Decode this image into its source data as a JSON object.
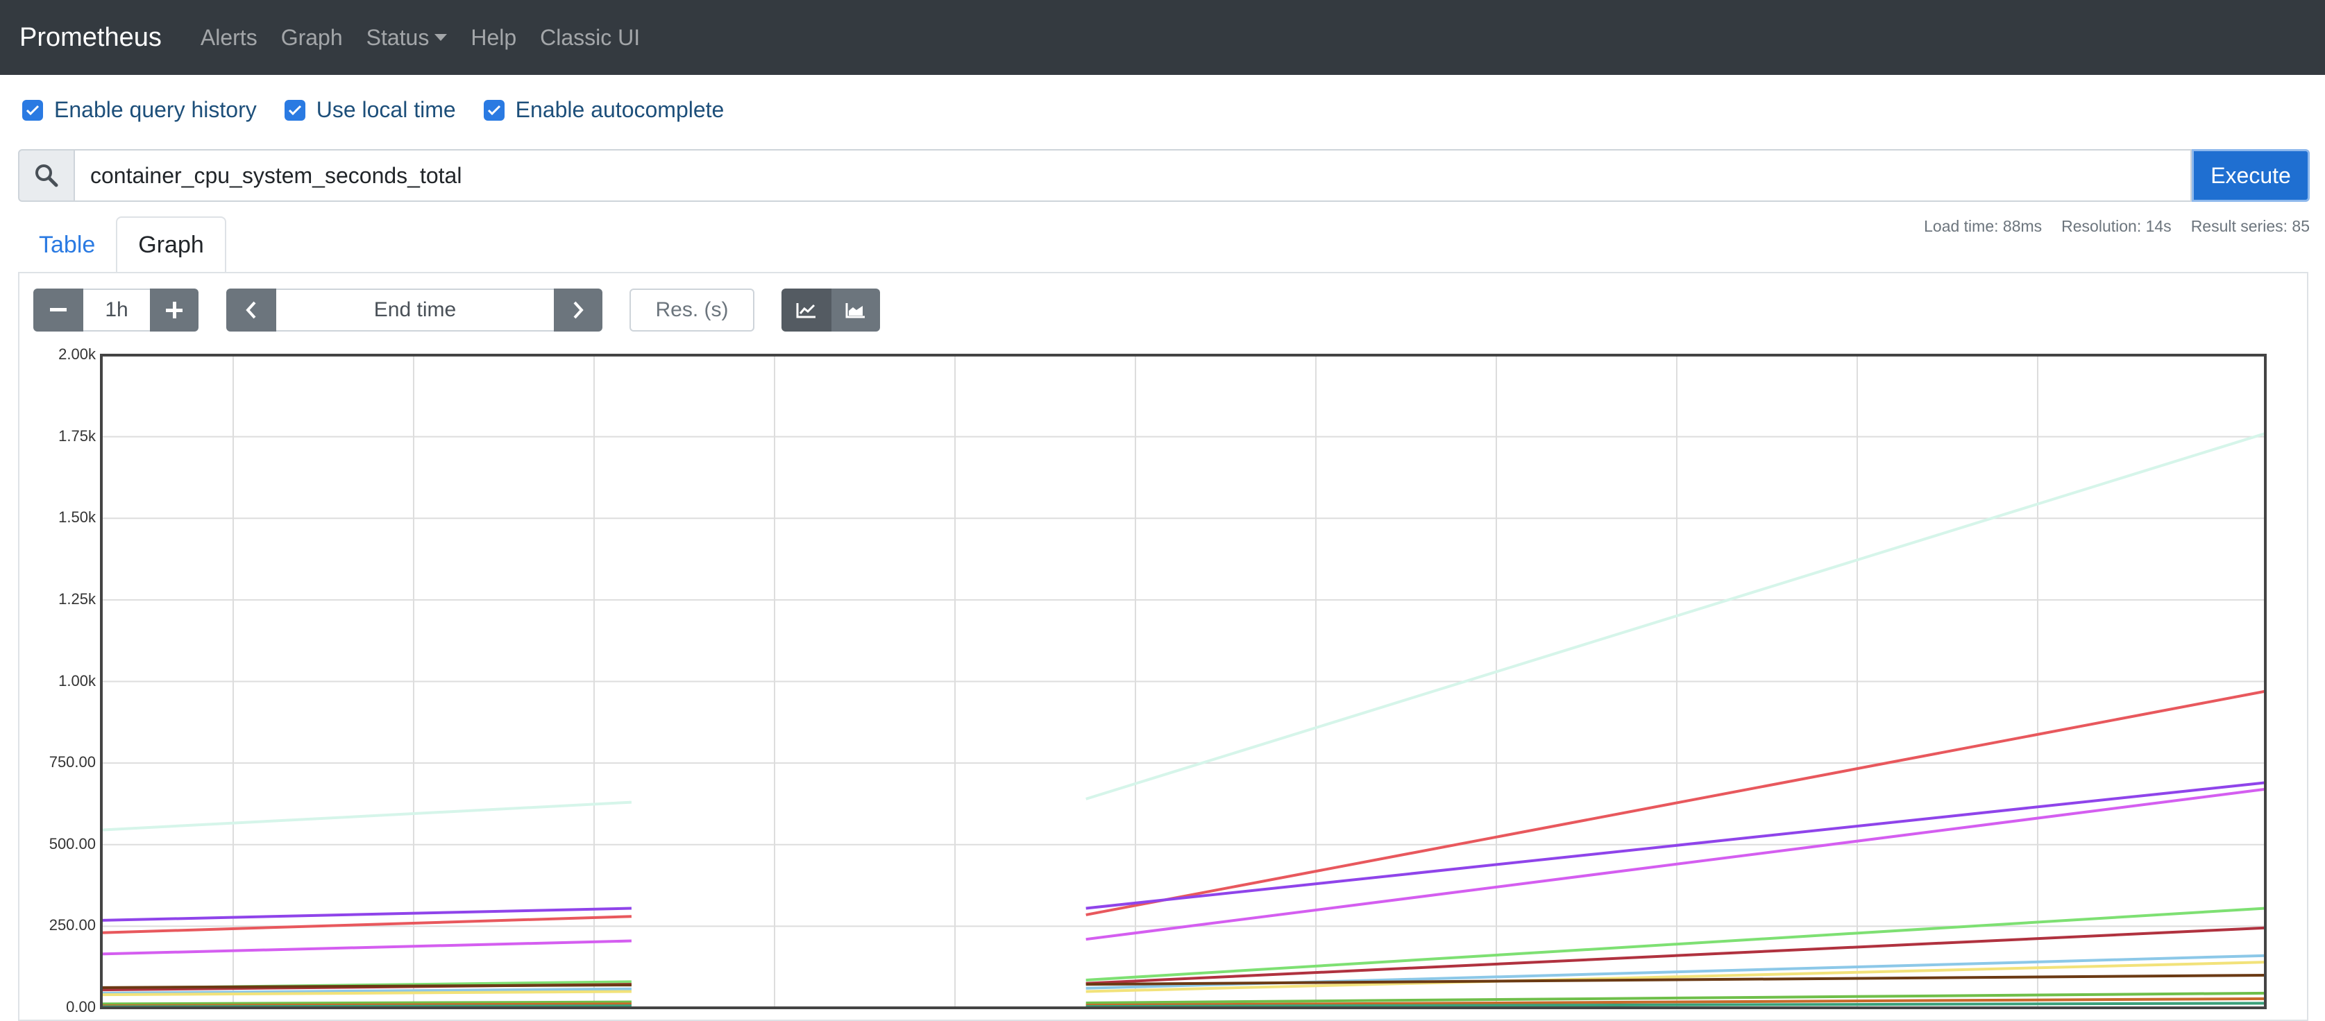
{
  "nav": {
    "brand": "Prometheus",
    "links": [
      "Alerts",
      "Graph",
      "Status",
      "Help",
      "Classic UI"
    ]
  },
  "options": [
    {
      "label": "Enable query history",
      "checked": true
    },
    {
      "label": "Use local time",
      "checked": true
    },
    {
      "label": "Enable autocomplete",
      "checked": true
    }
  ],
  "query": {
    "value": "container_cpu_system_seconds_total",
    "execute_label": "Execute"
  },
  "tabs": [
    {
      "label": "Table",
      "active": false
    },
    {
      "label": "Graph",
      "active": true
    }
  ],
  "stats": {
    "load_time": "Load time: 88ms",
    "resolution": "Resolution: 14s",
    "result_series": "Result series: 85"
  },
  "graph_controls": {
    "range": "1h",
    "end_time_placeholder": "End time",
    "resolution_placeholder": "Res. (s)"
  },
  "chart_data": {
    "type": "line",
    "ylim": [
      0,
      2000
    ],
    "y_ticks": [
      0,
      250,
      500,
      750,
      1000,
      1250,
      1500,
      1750,
      2000
    ],
    "y_tick_labels": [
      "0.00",
      "250.00",
      "500.00",
      "750.00",
      "1.00k",
      "1.25k",
      "1.50k",
      "1.75k",
      "2.00k"
    ],
    "x_range": [
      0,
      1
    ],
    "gap": [
      0.245,
      0.455
    ],
    "grid": true,
    "series": [
      {
        "color": "#d6f5ea",
        "seg1": [
          545,
          630
        ],
        "seg2": [
          640,
          1760
        ]
      },
      {
        "color": "#e8585d",
        "seg1": [
          230,
          280
        ],
        "seg2": [
          285,
          970
        ]
      },
      {
        "color": "#8f44ea",
        "seg1": [
          268,
          305
        ],
        "seg2": [
          305,
          690
        ]
      },
      {
        "color": "#d45ef0",
        "seg1": [
          165,
          205
        ],
        "seg2": [
          210,
          670
        ]
      },
      {
        "color": "#7ee073",
        "seg1": [
          60,
          80
        ],
        "seg2": [
          85,
          305
        ]
      },
      {
        "color": "#b0323f",
        "seg1": [
          55,
          72
        ],
        "seg2": [
          75,
          245
        ]
      },
      {
        "color": "#8cc8e8",
        "seg1": [
          45,
          58
        ],
        "seg2": [
          60,
          160
        ]
      },
      {
        "color": "#f2e27a",
        "seg1": [
          40,
          50
        ],
        "seg2": [
          50,
          140
        ]
      },
      {
        "color": "#6b3a14",
        "seg1": [
          62,
          70
        ],
        "seg2": [
          72,
          100
        ]
      },
      {
        "color": "#6fbf4a",
        "seg1": [
          12,
          18
        ],
        "seg2": [
          15,
          45
        ]
      },
      {
        "color": "#c76a2a",
        "seg1": [
          6,
          12
        ],
        "seg2": [
          8,
          28
        ]
      },
      {
        "color": "#3aa07a",
        "seg1": [
          3,
          6
        ],
        "seg2": [
          4,
          14
        ]
      }
    ]
  }
}
